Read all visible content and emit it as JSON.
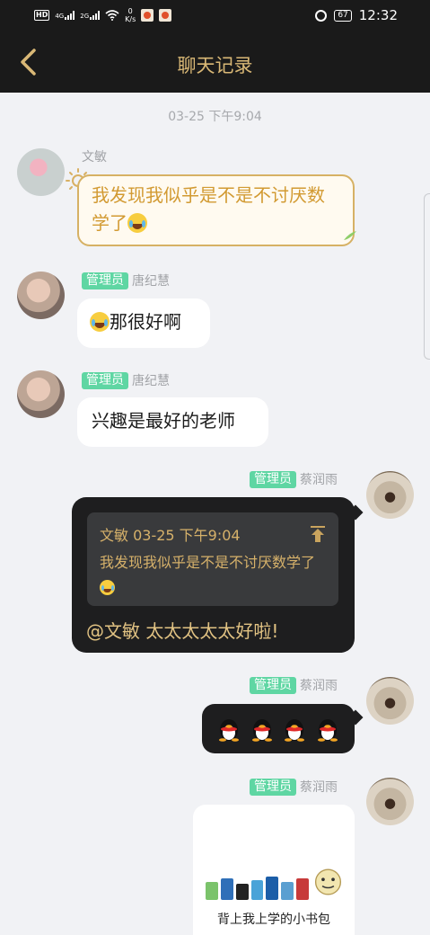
{
  "status_bar": {
    "hd": "HD",
    "net1": "4G",
    "net2": "2G",
    "speed_value": "0",
    "speed_unit": "K/s",
    "battery": "67",
    "time": "12:32"
  },
  "header": {
    "title": "聊天记录"
  },
  "time_separator": "03-25 下午9:04",
  "messages": [
    {
      "sender": "文敏",
      "text": "我发现我似乎是不是不讨厌数学了"
    },
    {
      "badge": "管理员",
      "sender": "唐纪慧",
      "text": "那很好啊"
    },
    {
      "badge": "管理员",
      "sender": "唐纪慧",
      "text": "兴趣是最好的老师"
    },
    {
      "badge": "管理员",
      "sender": "蔡润雨",
      "quote": {
        "header": "文敏 03-25 下午9:04",
        "text": "我发现我似乎是不是不讨厌数学了"
      },
      "text": "@文敏 太太太太太好啦!"
    },
    {
      "badge": "管理员",
      "sender": "蔡润雨",
      "stickers": [
        "penguin-emoji",
        "penguin-emoji",
        "penguin-emoji",
        "penguin-emoji"
      ]
    },
    {
      "badge": "管理员",
      "sender": "蔡润雨",
      "card_caption": "背上我上学的小书包"
    }
  ],
  "colors": {
    "header_bg": "#1a1a1a",
    "title_gold": "#d9b876",
    "admin_badge": "#5fd6a3",
    "dark_bubble": "#1e1e1f",
    "gold_text": "#e2c383"
  }
}
